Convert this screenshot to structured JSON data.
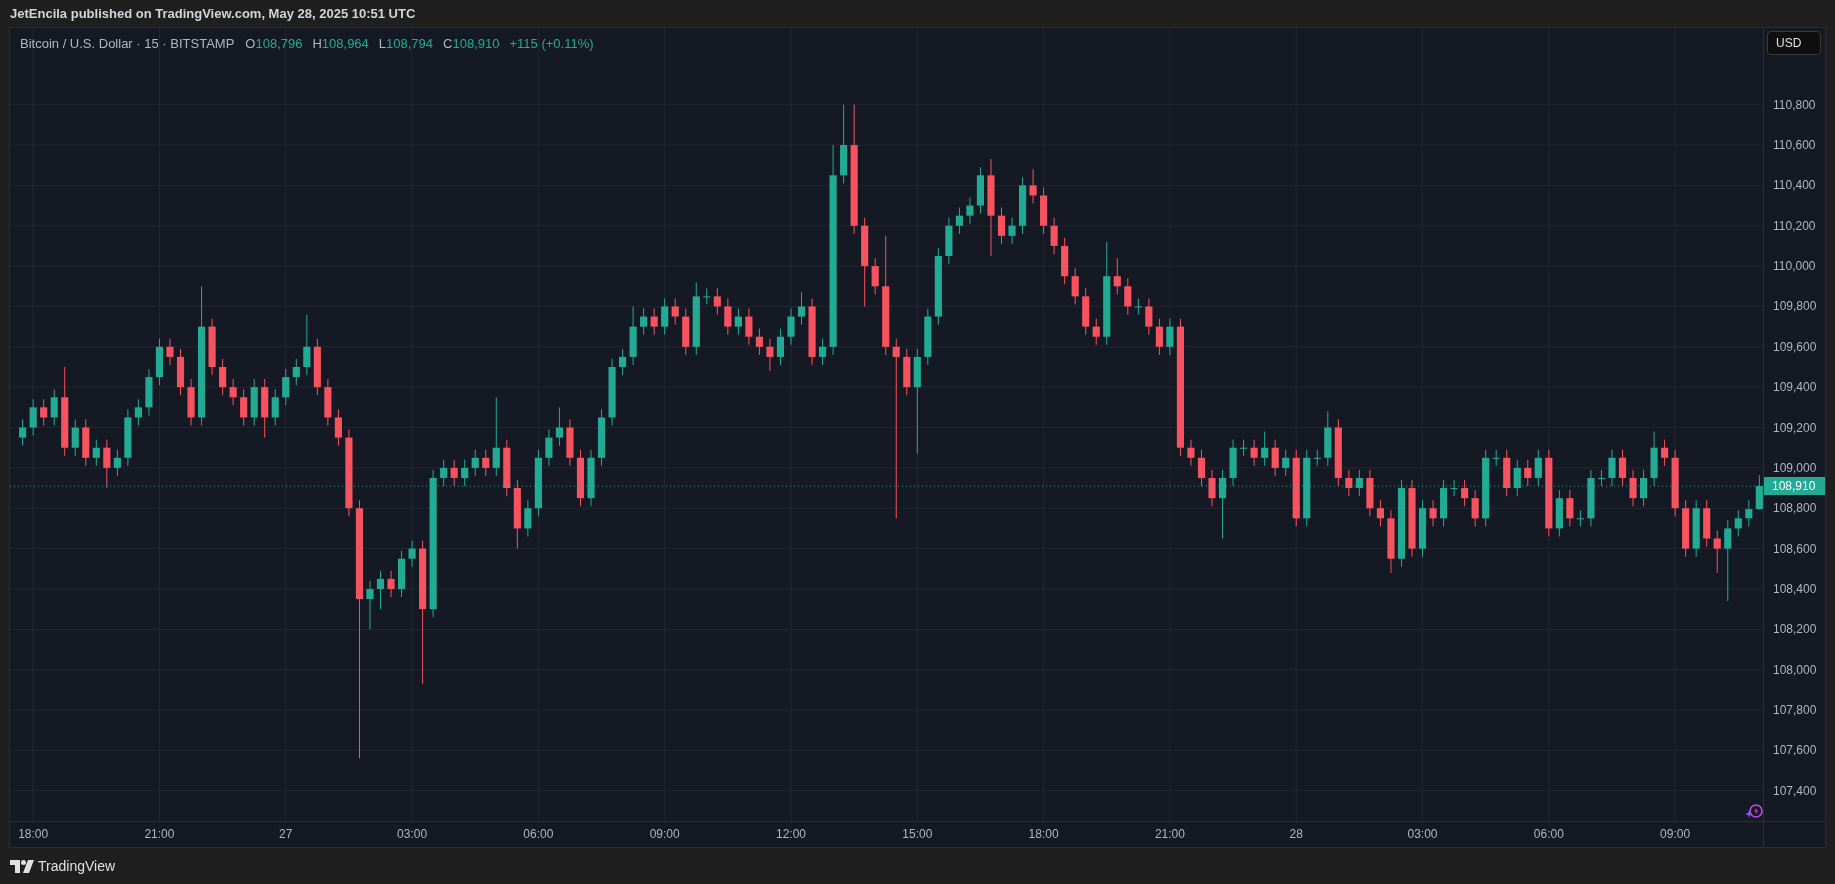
{
  "header": {
    "text": "JetEncila published on TradingView.com, May 28, 2025 10:51 UTC"
  },
  "legend": {
    "symbol": "Bitcoin / U.S. Dollar · 15 · BITSTAMP",
    "values": [
      {
        "label": "O",
        "value": "108,796"
      },
      {
        "label": "H",
        "value": "108,964"
      },
      {
        "label": "L",
        "value": "108,794"
      },
      {
        "label": "C",
        "value": "108,910"
      }
    ],
    "change": "+115 (+0.11%)"
  },
  "currency_button": "USD",
  "chart_data": {
    "type": "candlestick",
    "grid": true,
    "xlim": [
      "2025-05-26T17:27",
      "2025-05-28T12:35"
    ],
    "ylim": [
      107250,
      111180
    ],
    "xticks": [
      {
        "value": "2025-05-26T18:00",
        "label": "18:00"
      },
      {
        "value": "2025-05-26T21:00",
        "label": "21:00"
      },
      {
        "value": "2025-05-27T00:00",
        "label": "27"
      },
      {
        "value": "2025-05-27T03:00",
        "label": "03:00"
      },
      {
        "value": "2025-05-27T06:00",
        "label": "06:00"
      },
      {
        "value": "2025-05-27T09:00",
        "label": "09:00"
      },
      {
        "value": "2025-05-27T12:00",
        "label": "12:00"
      },
      {
        "value": "2025-05-27T15:00",
        "label": "15:00"
      },
      {
        "value": "2025-05-27T18:00",
        "label": "18:00"
      },
      {
        "value": "2025-05-27T21:00",
        "label": "21:00"
      },
      {
        "value": "2025-05-28T00:00",
        "label": "28"
      },
      {
        "value": "2025-05-28T03:00",
        "label": "03:00"
      },
      {
        "value": "2025-05-28T06:00",
        "label": "06:00"
      },
      {
        "value": "2025-05-28T09:00",
        "label": "09:00"
      }
    ],
    "yticks": [
      {
        "value": 107400,
        "label": "107,400"
      },
      {
        "value": 107600,
        "label": "107,600"
      },
      {
        "value": 107800,
        "label": "107,800"
      },
      {
        "value": 108000,
        "label": "108,000"
      },
      {
        "value": 108200,
        "label": "108,200"
      },
      {
        "value": 108400,
        "label": "108,400"
      },
      {
        "value": 108600,
        "label": "108,600"
      },
      {
        "value": 108800,
        "label": "108,800"
      },
      {
        "value": 109000,
        "label": "109,000"
      },
      {
        "value": 109200,
        "label": "109,200"
      },
      {
        "value": 109400,
        "label": "109,400"
      },
      {
        "value": 109600,
        "label": "109,600"
      },
      {
        "value": 109800,
        "label": "109,800"
      },
      {
        "value": 110000,
        "label": "110,000"
      },
      {
        "value": 110200,
        "label": "110,200"
      },
      {
        "value": 110400,
        "label": "110,400"
      },
      {
        "value": 110600,
        "label": "110,600"
      },
      {
        "value": 110800,
        "label": "110,800"
      }
    ],
    "x": [
      "2025-05-26T17:45",
      "2025-05-26T18:00",
      "2025-05-26T18:15",
      "2025-05-26T18:30",
      "2025-05-26T18:45",
      "2025-05-26T19:00",
      "2025-05-26T19:15",
      "2025-05-26T19:30",
      "2025-05-26T19:45",
      "2025-05-26T20:00",
      "2025-05-26T20:15",
      "2025-05-26T20:30",
      "2025-05-26T20:45",
      "2025-05-26T21:00",
      "2025-05-26T21:15",
      "2025-05-26T21:30",
      "2025-05-26T21:45",
      "2025-05-26T22:00",
      "2025-05-26T22:15",
      "2025-05-26T22:30",
      "2025-05-26T22:45",
      "2025-05-26T23:00",
      "2025-05-26T23:15",
      "2025-05-26T23:30",
      "2025-05-26T23:45",
      "2025-05-27T00:00",
      "2025-05-27T00:15",
      "2025-05-27T00:30",
      "2025-05-27T00:45",
      "2025-05-27T01:00",
      "2025-05-27T01:15",
      "2025-05-27T01:30",
      "2025-05-27T01:45",
      "2025-05-27T02:00",
      "2025-05-27T02:15",
      "2025-05-27T02:30",
      "2025-05-27T02:45",
      "2025-05-27T03:00",
      "2025-05-27T03:15",
      "2025-05-27T03:30",
      "2025-05-27T03:45",
      "2025-05-27T04:00",
      "2025-05-27T04:15",
      "2025-05-27T04:30",
      "2025-05-27T04:45",
      "2025-05-27T05:00",
      "2025-05-27T05:15",
      "2025-05-27T05:30",
      "2025-05-27T05:45",
      "2025-05-27T06:00",
      "2025-05-27T06:15",
      "2025-05-27T06:30",
      "2025-05-27T06:45",
      "2025-05-27T07:00",
      "2025-05-27T07:15",
      "2025-05-27T07:30",
      "2025-05-27T07:45",
      "2025-05-27T08:00",
      "2025-05-27T08:15",
      "2025-05-27T08:30",
      "2025-05-27T08:45",
      "2025-05-27T09:00",
      "2025-05-27T09:15",
      "2025-05-27T09:30",
      "2025-05-27T09:45",
      "2025-05-27T10:00",
      "2025-05-27T10:15",
      "2025-05-27T10:30",
      "2025-05-27T10:45",
      "2025-05-27T11:00",
      "2025-05-27T11:15",
      "2025-05-27T11:30",
      "2025-05-27T11:45",
      "2025-05-27T12:00",
      "2025-05-27T12:15",
      "2025-05-27T12:30",
      "2025-05-27T12:45",
      "2025-05-27T13:00",
      "2025-05-27T13:15",
      "2025-05-27T13:30",
      "2025-05-27T13:45",
      "2025-05-27T14:00",
      "2025-05-27T14:15",
      "2025-05-27T14:30",
      "2025-05-27T14:45",
      "2025-05-27T15:00",
      "2025-05-27T15:15",
      "2025-05-27T15:30",
      "2025-05-27T15:45",
      "2025-05-27T16:00",
      "2025-05-27T16:15",
      "2025-05-27T16:30",
      "2025-05-27T16:45",
      "2025-05-27T17:00",
      "2025-05-27T17:15",
      "2025-05-27T17:30",
      "2025-05-27T17:45",
      "2025-05-27T18:00",
      "2025-05-27T18:15",
      "2025-05-27T18:30",
      "2025-05-27T18:45",
      "2025-05-27T19:00",
      "2025-05-27T19:15",
      "2025-05-27T19:30",
      "2025-05-27T19:45",
      "2025-05-27T20:00",
      "2025-05-27T20:15",
      "2025-05-27T20:30",
      "2025-05-27T20:45",
      "2025-05-27T21:00",
      "2025-05-27T21:15",
      "2025-05-27T21:30",
      "2025-05-27T21:45",
      "2025-05-27T22:00",
      "2025-05-27T22:15",
      "2025-05-27T22:30",
      "2025-05-27T22:45",
      "2025-05-27T23:00",
      "2025-05-27T23:15",
      "2025-05-27T23:30",
      "2025-05-27T23:45",
      "2025-05-28T00:00",
      "2025-05-28T00:15",
      "2025-05-28T00:30",
      "2025-05-28T00:45",
      "2025-05-28T01:00",
      "2025-05-28T01:15",
      "2025-05-28T01:30",
      "2025-05-28T01:45",
      "2025-05-28T02:00",
      "2025-05-28T02:15",
      "2025-05-28T02:30",
      "2025-05-28T02:45",
      "2025-05-28T03:00",
      "2025-05-28T03:15",
      "2025-05-28T03:30",
      "2025-05-28T03:45",
      "2025-05-28T04:00",
      "2025-05-28T04:15",
      "2025-05-28T04:30",
      "2025-05-28T04:45",
      "2025-05-28T05:00",
      "2025-05-28T05:15",
      "2025-05-28T05:30",
      "2025-05-28T05:45",
      "2025-05-28T06:00",
      "2025-05-28T06:15",
      "2025-05-28T06:30",
      "2025-05-28T06:45",
      "2025-05-28T07:00",
      "2025-05-28T07:15",
      "2025-05-28T07:30",
      "2025-05-28T07:45",
      "2025-05-28T08:00",
      "2025-05-28T08:15",
      "2025-05-28T08:30",
      "2025-05-28T08:45",
      "2025-05-28T09:00",
      "2025-05-28T09:15",
      "2025-05-28T09:30",
      "2025-05-28T09:45",
      "2025-05-28T10:00",
      "2025-05-28T10:15",
      "2025-05-28T10:30",
      "2025-05-28T10:45",
      "2025-05-28T11:00"
    ],
    "ohlc": [
      [
        109150,
        109240,
        109110,
        109200
      ],
      [
        109200,
        109340,
        109160,
        109300
      ],
      [
        109300,
        109340,
        109210,
        109250
      ],
      [
        109250,
        109390,
        109210,
        109350
      ],
      [
        109350,
        109500,
        109060,
        109100
      ],
      [
        109100,
        109240,
        109060,
        109200
      ],
      [
        109200,
        109240,
        109010,
        109050
      ],
      [
        109050,
        109140,
        109010,
        109100
      ],
      [
        109100,
        109140,
        108900,
        109000
      ],
      [
        109000,
        109090,
        108960,
        109050
      ],
      [
        109050,
        109290,
        109010,
        109250
      ],
      [
        109250,
        109340,
        109210,
        109300
      ],
      [
        109300,
        109490,
        109260,
        109450
      ],
      [
        109450,
        109640,
        109410,
        109600
      ],
      [
        109600,
        109640,
        109510,
        109550
      ],
      [
        109550,
        109590,
        109360,
        109400
      ],
      [
        109400,
        109440,
        109210,
        109250
      ],
      [
        109250,
        109900,
        109210,
        109700
      ],
      [
        109700,
        109740,
        109460,
        109500
      ],
      [
        109500,
        109540,
        109360,
        109400
      ],
      [
        109400,
        109440,
        109310,
        109350
      ],
      [
        109350,
        109390,
        109210,
        109250
      ],
      [
        109250,
        109440,
        109210,
        109400
      ],
      [
        109400,
        109440,
        109150,
        109250
      ],
      [
        109250,
        109390,
        109210,
        109350
      ],
      [
        109350,
        109490,
        109310,
        109450
      ],
      [
        109450,
        109540,
        109410,
        109500
      ],
      [
        109500,
        109760,
        109460,
        109600
      ],
      [
        109600,
        109640,
        109360,
        109400
      ],
      [
        109400,
        109440,
        109210,
        109250
      ],
      [
        109250,
        109290,
        109110,
        109150
      ],
      [
        109150,
        109190,
        108760,
        108800
      ],
      [
        108800,
        108840,
        107560,
        108350
      ],
      [
        108350,
        108440,
        108200,
        108400
      ],
      [
        108400,
        108490,
        108300,
        108450
      ],
      [
        108450,
        108490,
        108360,
        108400
      ],
      [
        108400,
        108590,
        108360,
        108550
      ],
      [
        108550,
        108640,
        108510,
        108600
      ],
      [
        108600,
        108640,
        107930,
        108300
      ],
      [
        108300,
        108990,
        108260,
        108950
      ],
      [
        108950,
        109040,
        108910,
        109000
      ],
      [
        109000,
        109040,
        108910,
        108950
      ],
      [
        108950,
        109040,
        108910,
        109000
      ],
      [
        109000,
        109090,
        108960,
        109050
      ],
      [
        109050,
        109090,
        108960,
        109000
      ],
      [
        109000,
        109350,
        108960,
        109100
      ],
      [
        109100,
        109140,
        108860,
        108900
      ],
      [
        108900,
        108940,
        108600,
        108700
      ],
      [
        108700,
        108840,
        108660,
        108800
      ],
      [
        108800,
        109090,
        108760,
        109050
      ],
      [
        109050,
        109190,
        109010,
        109150
      ],
      [
        109150,
        109300,
        109110,
        109200
      ],
      [
        109200,
        109240,
        109010,
        109050
      ],
      [
        109050,
        109090,
        108810,
        108850
      ],
      [
        108850,
        109090,
        108810,
        109050
      ],
      [
        109050,
        109290,
        109010,
        109250
      ],
      [
        109250,
        109540,
        109210,
        109500
      ],
      [
        109500,
        109590,
        109460,
        109550
      ],
      [
        109550,
        109800,
        109510,
        109700
      ],
      [
        109700,
        109790,
        109660,
        109750
      ],
      [
        109750,
        109790,
        109660,
        109700
      ],
      [
        109700,
        109840,
        109660,
        109800
      ],
      [
        109800,
        109840,
        109710,
        109750
      ],
      [
        109750,
        109790,
        109560,
        109600
      ],
      [
        109600,
        109920,
        109560,
        109850
      ],
      [
        109850,
        109890,
        109810,
        109850
      ],
      [
        109850,
        109890,
        109760,
        109800
      ],
      [
        109800,
        109840,
        109660,
        109700
      ],
      [
        109700,
        109790,
        109660,
        109750
      ],
      [
        109750,
        109790,
        109610,
        109650
      ],
      [
        109650,
        109690,
        109560,
        109600
      ],
      [
        109600,
        109640,
        109480,
        109550
      ],
      [
        109550,
        109690,
        109510,
        109650
      ],
      [
        109650,
        109790,
        109610,
        109750
      ],
      [
        109750,
        109870,
        109710,
        109800
      ],
      [
        109800,
        109840,
        109510,
        109550
      ],
      [
        109550,
        109640,
        109510,
        109600
      ],
      [
        109600,
        110600,
        109560,
        110450
      ],
      [
        110450,
        110800,
        110410,
        110600
      ],
      [
        110600,
        110800,
        110160,
        110200
      ],
      [
        110200,
        110240,
        109800,
        110000
      ],
      [
        110000,
        110040,
        109860,
        109900
      ],
      [
        109900,
        110150,
        109560,
        109600
      ],
      [
        109600,
        109640,
        108750,
        109550
      ],
      [
        109550,
        109590,
        109360,
        109400
      ],
      [
        109400,
        109590,
        109070,
        109550
      ],
      [
        109550,
        109790,
        109510,
        109750
      ],
      [
        109750,
        110090,
        109710,
        110050
      ],
      [
        110050,
        110240,
        110010,
        110200
      ],
      [
        110200,
        110290,
        110160,
        110250
      ],
      [
        110250,
        110340,
        110210,
        110300
      ],
      [
        110300,
        110490,
        110260,
        110450
      ],
      [
        110450,
        110530,
        110050,
        110250
      ],
      [
        110250,
        110290,
        110110,
        110150
      ],
      [
        110150,
        110240,
        110110,
        110200
      ],
      [
        110200,
        110440,
        110160,
        110400
      ],
      [
        110400,
        110480,
        110310,
        110350
      ],
      [
        110350,
        110390,
        110160,
        110200
      ],
      [
        110200,
        110240,
        110060,
        110100
      ],
      [
        110100,
        110140,
        109910,
        109950
      ],
      [
        109950,
        109990,
        109810,
        109850
      ],
      [
        109850,
        109890,
        109660,
        109700
      ],
      [
        109700,
        109740,
        109610,
        109650
      ],
      [
        109650,
        110120,
        109610,
        109950
      ],
      [
        109950,
        110040,
        109860,
        109900
      ],
      [
        109900,
        109940,
        109760,
        109800
      ],
      [
        109800,
        109840,
        109760,
        109800
      ],
      [
        109800,
        109840,
        109660,
        109700
      ],
      [
        109700,
        109740,
        109560,
        109600
      ],
      [
        109600,
        109740,
        109560,
        109700
      ],
      [
        109700,
        109740,
        109060,
        109100
      ],
      [
        109100,
        109140,
        109010,
        109050
      ],
      [
        109050,
        109090,
        108910,
        108950
      ],
      [
        108950,
        108990,
        108810,
        108850
      ],
      [
        108850,
        108990,
        108650,
        108950
      ],
      [
        108950,
        109140,
        108910,
        109100
      ],
      [
        109100,
        109140,
        109060,
        109100
      ],
      [
        109100,
        109140,
        109010,
        109050
      ],
      [
        109050,
        109180,
        109010,
        109100
      ],
      [
        109100,
        109140,
        108960,
        109000
      ],
      [
        109000,
        109090,
        108960,
        109050
      ],
      [
        109050,
        109090,
        108710,
        108750
      ],
      [
        108750,
        109090,
        108710,
        109050
      ],
      [
        109050,
        109090,
        109010,
        109050
      ],
      [
        109050,
        109280,
        109010,
        109200
      ],
      [
        109200,
        109240,
        108910,
        108950
      ],
      [
        108950,
        108990,
        108860,
        108900
      ],
      [
        108900,
        108990,
        108860,
        108950
      ],
      [
        108950,
        108990,
        108760,
        108800
      ],
      [
        108800,
        108840,
        108710,
        108750
      ],
      [
        108750,
        108790,
        108480,
        108550
      ],
      [
        108550,
        108940,
        108510,
        108900
      ],
      [
        108900,
        108940,
        108560,
        108600
      ],
      [
        108600,
        108840,
        108560,
        108800
      ],
      [
        108800,
        108840,
        108710,
        108750
      ],
      [
        108750,
        108940,
        108710,
        108900
      ],
      [
        108900,
        108940,
        108860,
        108900
      ],
      [
        108900,
        108940,
        108810,
        108850
      ],
      [
        108850,
        108890,
        108710,
        108750
      ],
      [
        108750,
        109090,
        108710,
        109050
      ],
      [
        109050,
        109090,
        109010,
        109050
      ],
      [
        109050,
        109090,
        108860,
        108900
      ],
      [
        108900,
        109040,
        108860,
        109000
      ],
      [
        109000,
        109040,
        108910,
        108950
      ],
      [
        108950,
        109090,
        108910,
        109050
      ],
      [
        109050,
        109090,
        108660,
        108700
      ],
      [
        108700,
        108890,
        108660,
        108850
      ],
      [
        108850,
        108890,
        108710,
        108750
      ],
      [
        108750,
        108790,
        108710,
        108750
      ],
      [
        108750,
        108990,
        108710,
        108950
      ],
      [
        108950,
        108990,
        108910,
        108950
      ],
      [
        108950,
        109090,
        108910,
        109050
      ],
      [
        109050,
        109090,
        108910,
        108950
      ],
      [
        108950,
        108990,
        108810,
        108850
      ],
      [
        108850,
        108990,
        108810,
        108950
      ],
      [
        108950,
        109180,
        108910,
        109100
      ],
      [
        109100,
        109140,
        109010,
        109050
      ],
      [
        109050,
        109090,
        108760,
        108800
      ],
      [
        108800,
        108840,
        108560,
        108600
      ],
      [
        108600,
        108840,
        108560,
        108800
      ],
      [
        108800,
        108840,
        108610,
        108650
      ],
      [
        108650,
        108690,
        108480,
        108600
      ],
      [
        108600,
        108740,
        108340,
        108700
      ],
      [
        108700,
        108790,
        108660,
        108750
      ],
      [
        108750,
        108840,
        108710,
        108796
      ],
      [
        108796,
        108964,
        108794,
        108910
      ]
    ],
    "ref_lines": [
      {
        "axis": "y",
        "value": 108910,
        "label": "108,910"
      }
    ]
  },
  "footer": {
    "brand": "TradingView"
  }
}
